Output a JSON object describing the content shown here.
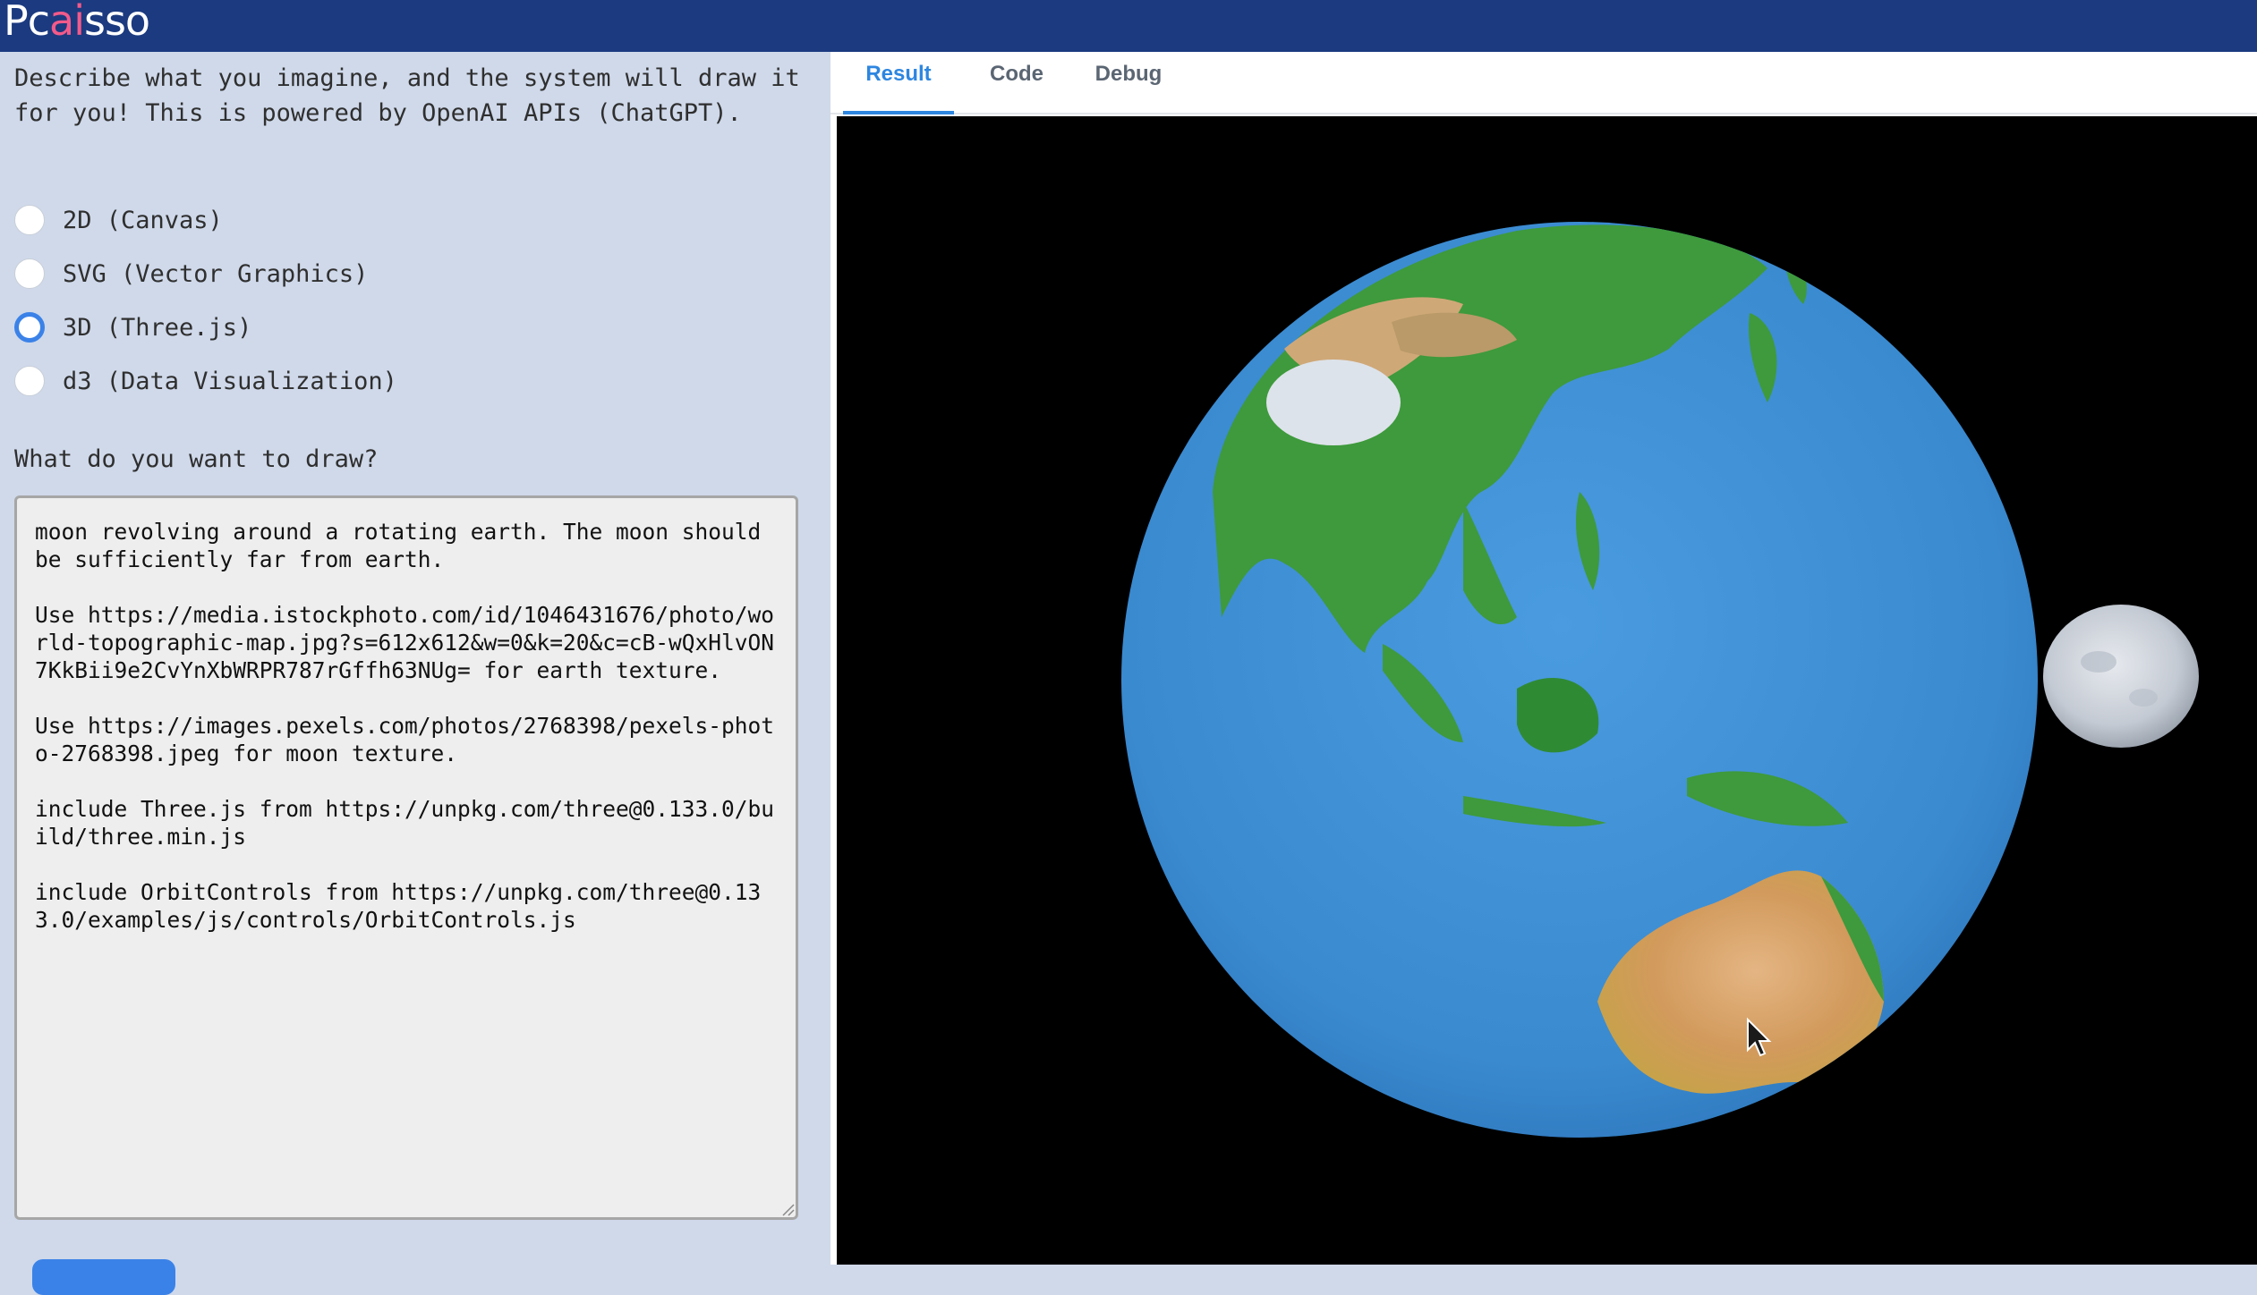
{
  "app": {
    "logo_prefix": "Pc",
    "logo_accent": "ai",
    "logo_suffix": "sso"
  },
  "left_panel": {
    "intro": "Describe what you imagine, and the system will draw it for you! This is powered by OpenAI APIs (ChatGPT).",
    "modes": [
      {
        "label": "2D (Canvas)",
        "selected": false
      },
      {
        "label": "SVG (Vector Graphics)",
        "selected": false
      },
      {
        "label": "3D (Three.js)",
        "selected": true
      },
      {
        "label": "d3 (Data Visualization)",
        "selected": false
      }
    ],
    "question": "What do you want to draw?",
    "prompt_text": "moon revolving around a rotating earth. The moon should be sufficiently far from earth.\n\nUse https://media.istockphoto.com/id/1046431676/photo/world-topographic-map.jpg?s=612x612&w=0&k=20&c=cB-wQxHlvON7KkBii9e2CvYnXbWRPR787rGffh63NUg= for earth texture.\n\nUse https://images.pexels.com/photos/2768398/pexels-photo-2768398.jpeg for moon texture.\n\ninclude Three.js from https://unpkg.com/three@0.133.0/build/three.min.js\n\ninclude OrbitControls from https://unpkg.com/three@0.133.0/examples/js/controls/OrbitControls.js"
  },
  "right_panel": {
    "tabs": [
      {
        "label": "Result",
        "active": true
      },
      {
        "label": "Code",
        "active": false
      },
      {
        "label": "Debug",
        "active": false
      }
    ]
  },
  "colors": {
    "header_bg": "#1b3a80",
    "accent_blue": "#3b82e8",
    "ocean": "#3f8fd3",
    "land_green": "#3c9a3a",
    "desert": "#d6a25e"
  }
}
